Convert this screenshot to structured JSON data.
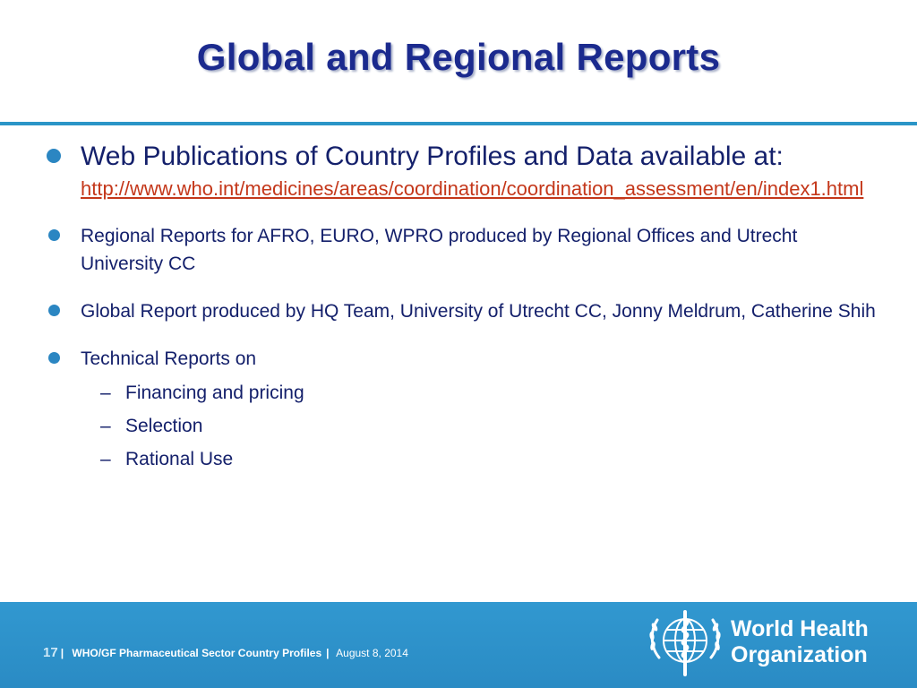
{
  "slide": {
    "title": "Global and Regional Reports",
    "bullets": [
      {
        "text": "Web Publications of Country Profiles and Data available at:",
        "link": "http://www.who.int/medicines/areas/coordination/coordination_assessment/en/index1.html"
      },
      {
        "text": "Regional Reports for AFRO, EURO, WPRO produced by Regional Offices and Utrecht University CC"
      },
      {
        "text": "Global Report produced by HQ Team, University of Utrecht CC, Jonny Meldrum, Catherine Shih"
      },
      {
        "text": "Technical Reports on",
        "subitems": [
          "Financing and pricing",
          "Selection",
          "Rational Use"
        ]
      }
    ]
  },
  "footer": {
    "page_number": "17",
    "separator": "|",
    "deck_name": "WHO/GF Pharmaceutical Sector Country Profiles",
    "date": "August 8, 2014",
    "org_name_line1": "World Health",
    "org_name_line2": "Organization",
    "logo_icon": "who-emblem-icon"
  },
  "colors": {
    "title": "#1b2a8e",
    "text": "#14206b",
    "accent": "#2b95c7",
    "link": "#c4371a",
    "footer_bg": "#2a8bc4"
  }
}
